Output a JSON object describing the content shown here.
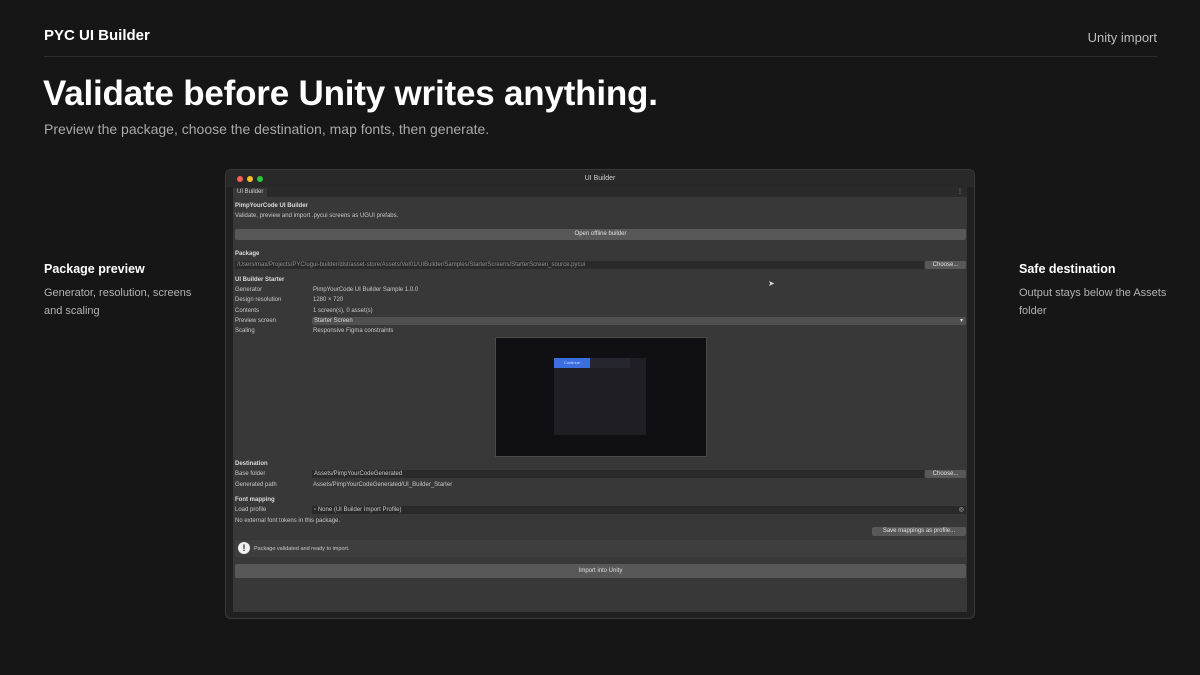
{
  "brand": "PYC UI Builder",
  "top_link": "Unity import",
  "headline": "Validate before Unity writes anything.",
  "subline": "Preview the package, choose the destination, map fonts, then generate.",
  "left_note": {
    "title": "Package preview",
    "desc": "Generator, resolution, screens and scaling"
  },
  "right_note": {
    "title": "Safe destination",
    "desc": "Output stays below the Assets folder"
  },
  "window": {
    "title": "UI Builder",
    "tab": "UI Builder",
    "menu": "⋮",
    "product_title": "PimpYourCode UI Builder",
    "product_desc": "Validate, preview and import .pycui screens as UGUI prefabs.",
    "open_offline": "Open offline builder",
    "package_label": "Package",
    "package_path": "/Users/max/Projects/PYC/ugui-builder/dist/asset-store/Assets/Vel01/UIBuilder/Samples/StarterScreens/StarterScreen_source.pycui",
    "choose": "Choose...",
    "starter_title": "UI Builder Starter",
    "rows": [
      {
        "label": "Generator",
        "value": "PimpYourCode UI Builder Sample 1.0.0"
      },
      {
        "label": "Design resolution",
        "value": "1280 × 720"
      },
      {
        "label": "Contents",
        "value": "1 screen(s), 0 asset(s)"
      }
    ],
    "preview_screen_label": "Preview screen",
    "preview_screen_value": "Starter Screen",
    "scaling_label": "Scaling",
    "scaling_value": "Responsive Figma constraints",
    "preview_button": "Continue",
    "destination_label": "Destination",
    "base_folder_label": "Base folder",
    "base_folder_value": "Assets/PimpYourCodeGenerated",
    "choose2": "Choose...",
    "generated_path_label": "Generated path",
    "generated_path_value": "Assets/PimpYourCodeGenerated/UI_Builder_Starter",
    "font_mapping_label": "Font mapping",
    "load_profile_label": "Load profile",
    "load_profile_value": "None (UI Builder Import Profile)",
    "no_tokens": "No external font tokens in this package.",
    "save_mappings": "Save mappings as profile...",
    "status": "Package validated and ready to import.",
    "import_button": "Import into Unity"
  },
  "colors": {
    "accent": "#3b6fe0",
    "background": "#161616"
  }
}
